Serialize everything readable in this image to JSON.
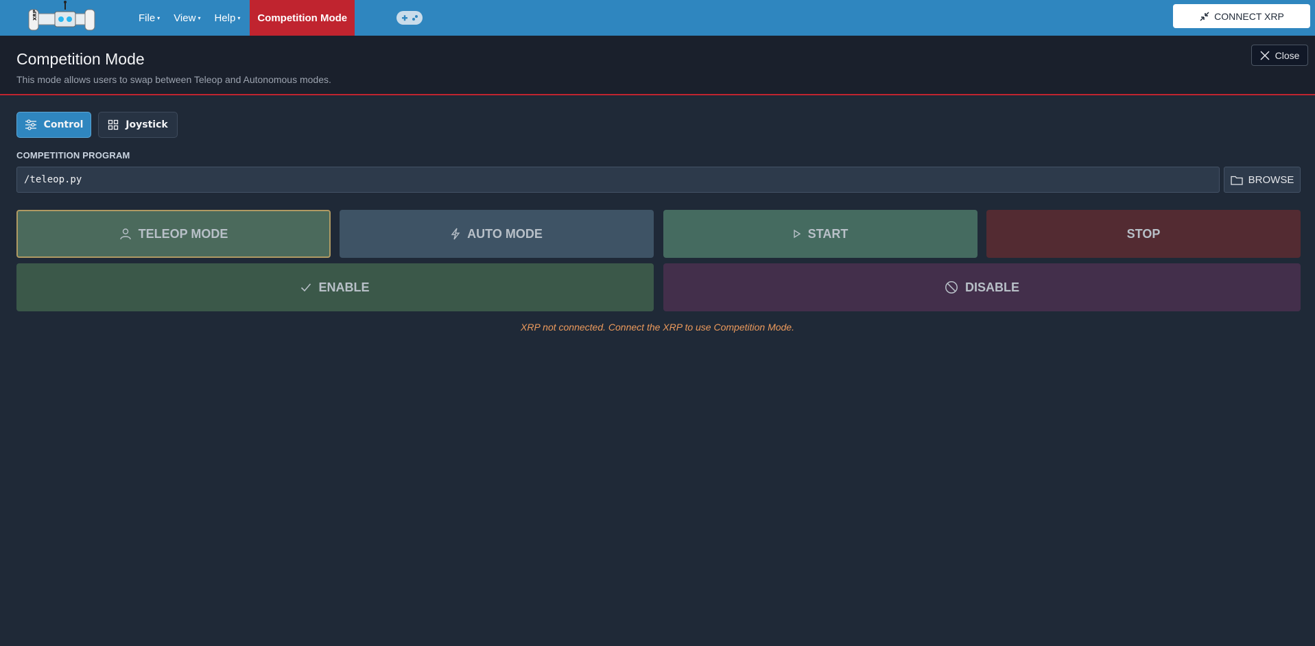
{
  "navbar": {
    "menu": [
      {
        "label": "File",
        "caret": "▾"
      },
      {
        "label": "View",
        "caret": "▾"
      },
      {
        "label": "Help",
        "caret": "▾"
      }
    ],
    "active_mode": "Competition Mode",
    "connect_label": "CONNECT XRP",
    "logo_text": "XRP",
    "icons": [
      "xrp-robot-logo",
      "gamepad-icon",
      "connect-arrows-icon"
    ]
  },
  "header": {
    "title": "Competition Mode",
    "subtitle": "This mode allows users to swap between Teleop and Autonomous modes.",
    "close_label": "Close"
  },
  "tabs": [
    {
      "label": "Control",
      "active": true,
      "icon": "sliders-icon"
    },
    {
      "label": "Joystick",
      "active": false,
      "icon": "grid-icon"
    }
  ],
  "program": {
    "label": "COMPETITION PROGRAM",
    "value": "/teleop.py",
    "browse_label": "BROWSE"
  },
  "controls": {
    "teleop": "TELEOP MODE",
    "auto": "AUTO MODE",
    "start": "START",
    "stop": "STOP",
    "enable": "ENABLE",
    "disable": "DISABLE"
  },
  "status_message": "XRP not connected. Connect the XRP to use Competition Mode.",
  "colors": {
    "navbar": "#2f86bf",
    "accent_red": "#c0242f",
    "background": "#1f2937",
    "warning_text": "#ec9a5c"
  }
}
